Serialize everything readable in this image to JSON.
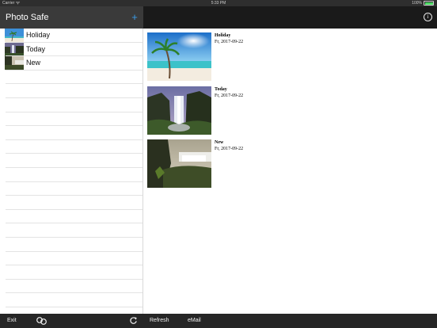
{
  "status_bar": {
    "carrier": "Carrier",
    "time": "5:33 PM",
    "battery": "100%"
  },
  "sidebar": {
    "title": "Photo Safe",
    "add_label": "+",
    "items": [
      {
        "label": "Holiday"
      },
      {
        "label": "Today"
      },
      {
        "label": "New"
      }
    ]
  },
  "header": {
    "info_label": "i"
  },
  "albums": [
    {
      "title": "Holiday",
      "date": "Fr, 2017-09-22"
    },
    {
      "title": "Today",
      "date": "Fr, 2017-09-22"
    },
    {
      "title": "New",
      "date": "Fr, 2017-09-22"
    }
  ],
  "toolbar": {
    "exit_label": "Exit",
    "refresh_label": "Refresh",
    "email_label": "eMail"
  },
  "colors": {
    "accent": "#3a9be8",
    "battery": "#4cd964"
  }
}
